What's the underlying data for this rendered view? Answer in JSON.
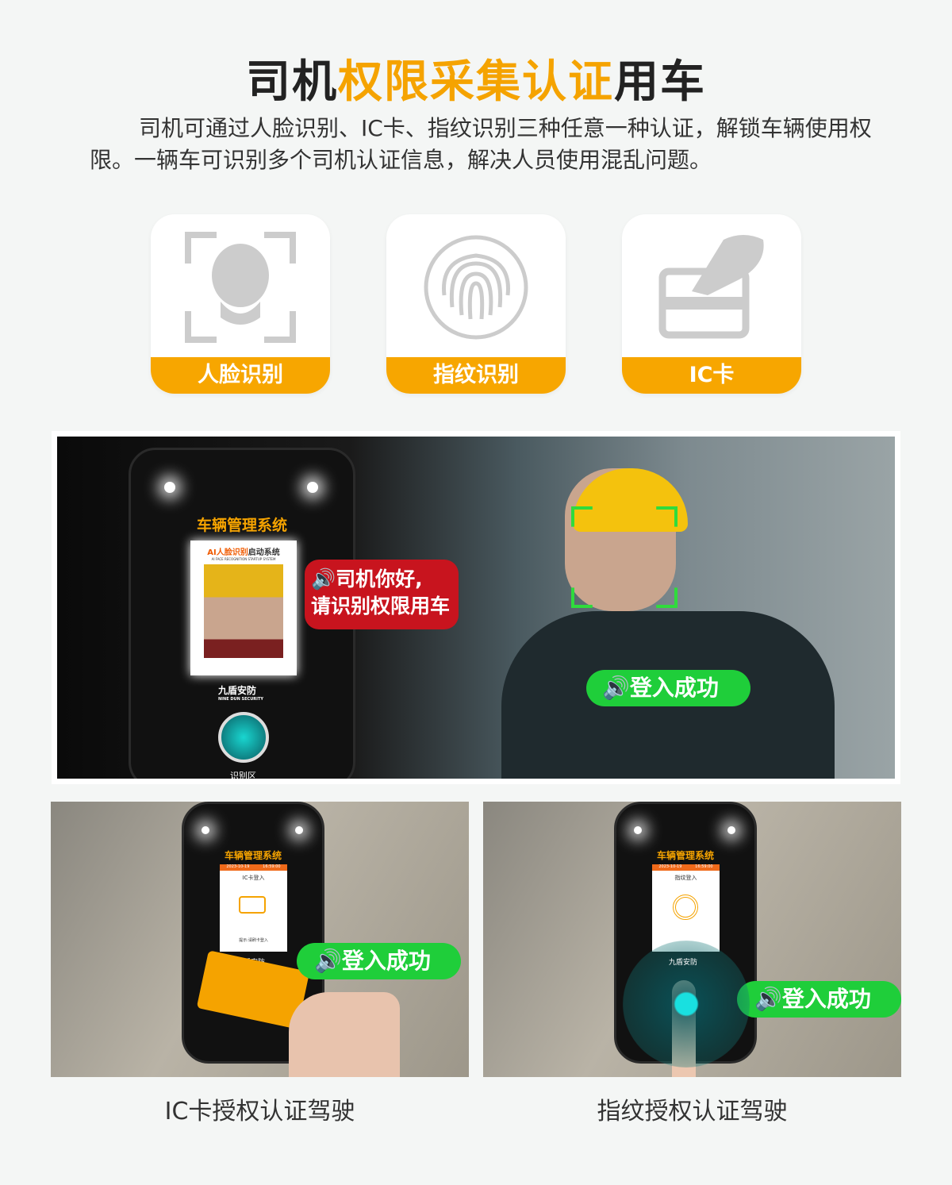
{
  "header": {
    "title_a": "司机",
    "title_b": "权限采集认证",
    "title_c": "用车",
    "description": "司机可通过人脸识别、IC卡、指纹识别三种任意一种认证，解锁车辆使用权限。一辆车可识别多个司机认证信息，解决人员使用混乱问题。"
  },
  "methods": [
    {
      "label": "人脸识别",
      "icon": "face-scan-icon"
    },
    {
      "label": "指纹识别",
      "icon": "fingerprint-icon"
    },
    {
      "label": "IC卡",
      "icon": "card-in-hand-icon"
    }
  ],
  "main_photo": {
    "device_title": "车辆管理系统",
    "screen_title_a": "AI人脸识别",
    "screen_title_b": "启动系统",
    "screen_subtitle": "AI FACE RECOGNITION STARTUP SYSTEM",
    "brand": "九盾安防",
    "brand_en": "NINE DUN SECURITY",
    "zone": "识别区",
    "prompt_line1": "司机你好,",
    "prompt_line2": "请识别权限用车",
    "success": "登入成功"
  },
  "ic_photo": {
    "device_title": "车辆管理系统",
    "date": "2023-10-19",
    "time": "16:59:00",
    "screen_title": "IC卡登入",
    "hint": "提示:请刷卡登入",
    "brand": "九盾安防",
    "success": "登入成功",
    "caption": "IC卡授权认证驾驶"
  },
  "fp_photo": {
    "device_title": "车辆管理系统",
    "date": "2023-10-19",
    "time": "16:59:00",
    "screen_title": "指纹登入",
    "brand": "九盾安防",
    "success": "登入成功",
    "caption": "指纹授权认证驾驶"
  },
  "colors": {
    "accent": "#f7a600",
    "success": "#1fce3a",
    "alert": "#c8141e"
  }
}
